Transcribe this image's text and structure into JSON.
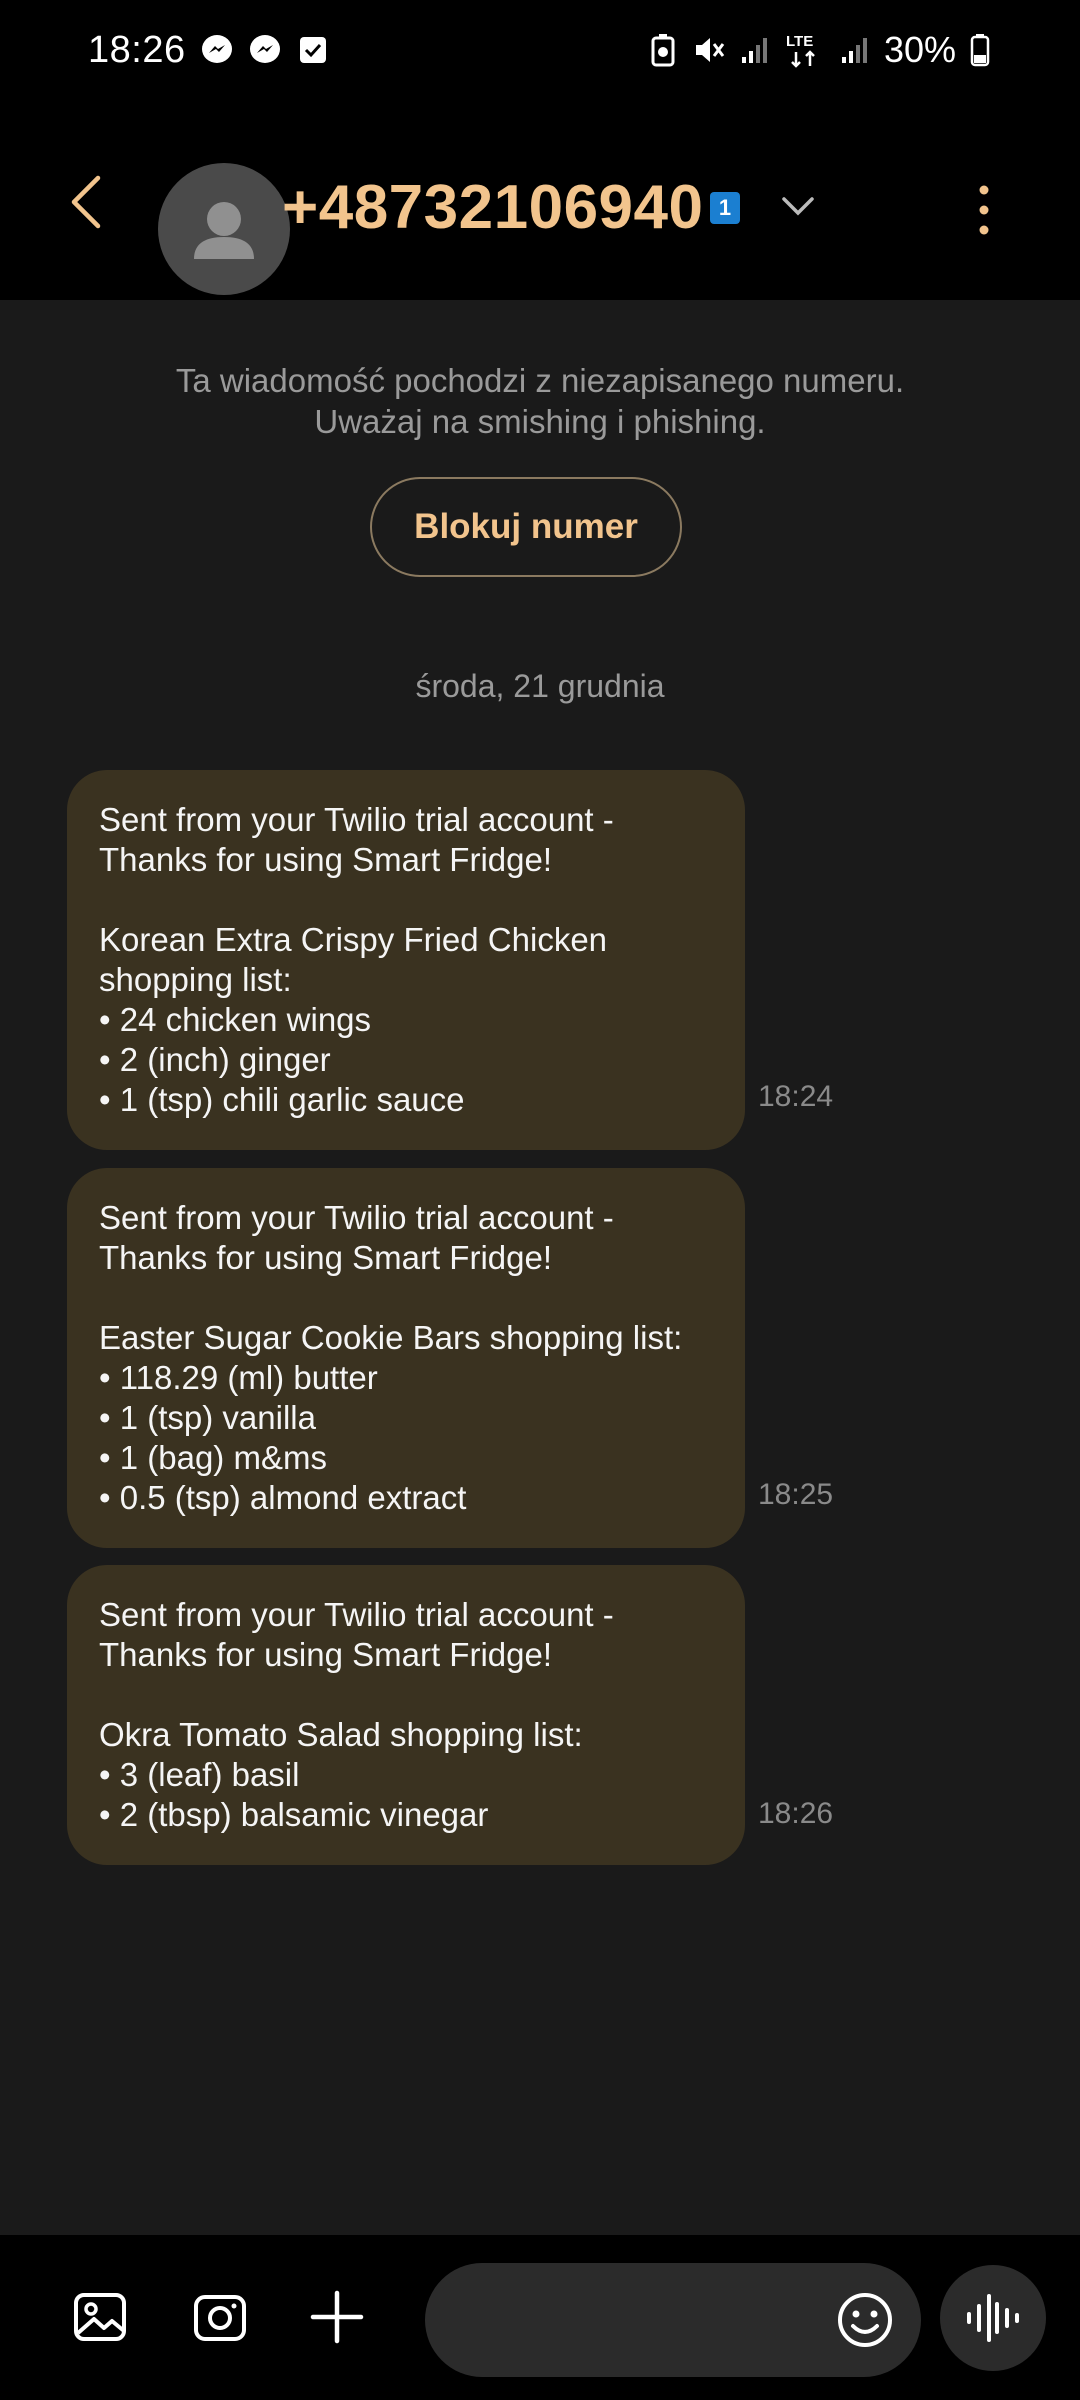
{
  "status_bar": {
    "time": "18:26",
    "battery": "30%",
    "network": "LTE",
    "notification_icons": [
      "messenger-icon",
      "messenger-icon",
      "check-box-icon"
    ],
    "system_icons": [
      "battery-saver-icon",
      "mute-icon",
      "signal-icon",
      "lte-icon",
      "signal-icon",
      "battery-icon"
    ]
  },
  "header": {
    "contact": "+48732106940",
    "sim_badge": "1",
    "accent_color": "#f2c48d"
  },
  "banner": {
    "warning_line1": "Ta wiadomość pochodzi z niezapisanego numeru.",
    "warning_line2": "Uważaj na smishing i phishing.",
    "block_button": "Blokuj numer"
  },
  "date_separator": "środa, 21 grudnia",
  "messages": [
    {
      "lines": [
        "Sent from your Twilio trial account -",
        "Thanks for using Smart Fridge!",
        "",
        "Korean Extra Crispy Fried Chicken",
        "shopping list:",
        "• 24 chicken wings",
        "• 2 (inch) ginger",
        "• 1 (tsp) chili garlic sauce"
      ],
      "time": "18:24"
    },
    {
      "lines": [
        "Sent from your Twilio trial account -",
        "Thanks for using Smart Fridge!",
        "",
        "Easter Sugar Cookie Bars shopping list:",
        "• 118.29 (ml) butter",
        "• 1 (tsp) vanilla",
        "• 1 (bag) m&ms",
        "• 0.5 (tsp) almond extract"
      ],
      "time": "18:25"
    },
    {
      "lines": [
        "Sent from your Twilio trial account -",
        "Thanks for using Smart Fridge!",
        "",
        "Okra Tomato Salad shopping list:",
        "• 3 (leaf) basil",
        "• 2 (tbsp) balsamic vinegar"
      ],
      "time": "18:26"
    }
  ],
  "bottom_bar": {
    "icons": [
      "gallery-icon",
      "camera-icon",
      "plus-icon",
      "emoji-icon",
      "voice-icon"
    ],
    "input_value": ""
  }
}
